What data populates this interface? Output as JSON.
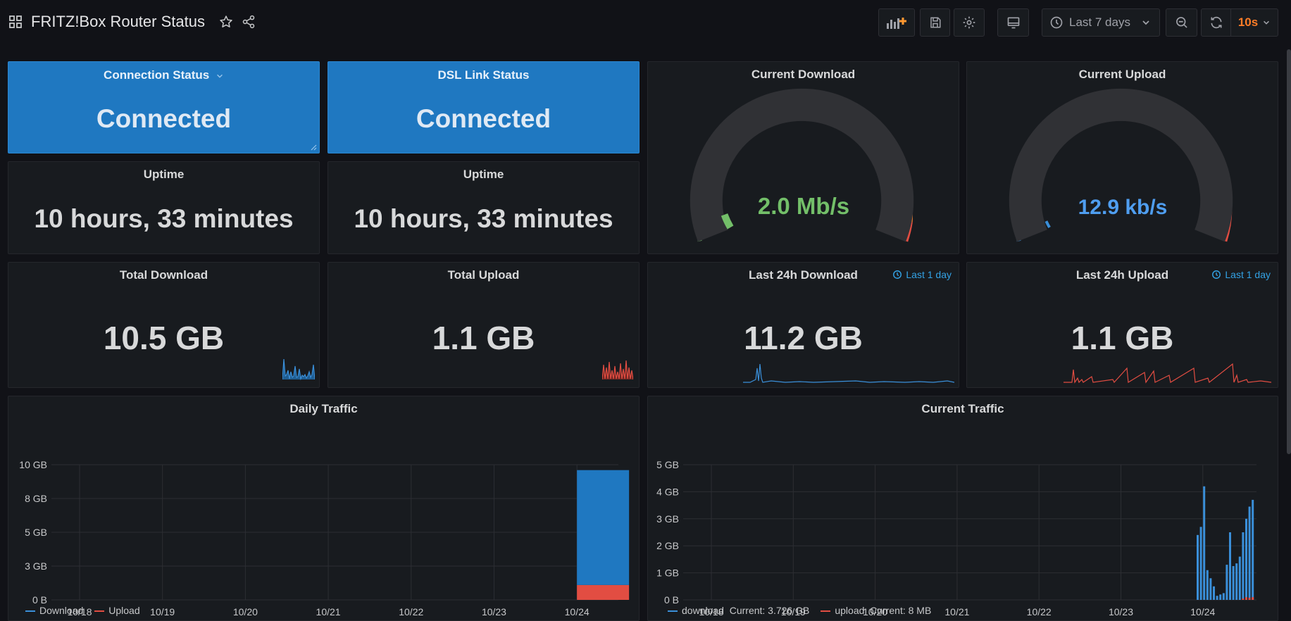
{
  "header": {
    "title": "FRITZ!Box Router Status",
    "time_range": "Last 7 days",
    "refresh": "10s"
  },
  "panels": {
    "connection_status": {
      "title": "Connection Status",
      "value": "Connected"
    },
    "dsl_link_status": {
      "title": "DSL Link Status",
      "value": "Connected"
    },
    "uptime_1": {
      "title": "Uptime",
      "value": "10 hours, 33 minutes"
    },
    "uptime_2": {
      "title": "Uptime",
      "value": "10 hours, 33 minutes"
    },
    "current_download": {
      "title": "Current Download",
      "value": "2.0 Mb/s",
      "fraction": 0.04
    },
    "current_upload": {
      "title": "Current Upload",
      "value": "12.9 kb/s",
      "fraction": 0.02
    },
    "total_download": {
      "title": "Total Download",
      "value": "10.5 GB"
    },
    "total_upload": {
      "title": "Total Upload",
      "value": "1.1 GB"
    },
    "last24_download": {
      "title": "Last 24h Download",
      "value": "11.2 GB",
      "time_info": "Last 1 day"
    },
    "last24_upload": {
      "title": "Last 24h Upload",
      "value": "1.1 GB",
      "time_info": "Last 1 day"
    },
    "daily_traffic": {
      "title": "Daily Traffic"
    },
    "current_traffic": {
      "title": "Current Traffic"
    }
  },
  "colors": {
    "blue": "#1f78c1",
    "green": "#73bf69",
    "orange": "#e0752d",
    "red": "#e24d42",
    "series_blue": "#3a8fd9"
  },
  "chart_data": [
    {
      "type": "bar",
      "title": "Daily Traffic",
      "categories": [
        "10/18",
        "10/19",
        "10/20",
        "10/21",
        "10/22",
        "10/23",
        "10/24"
      ],
      "yticks": [
        "0 B",
        "3 GB",
        "5 GB",
        "8 GB",
        "10 GB"
      ],
      "ylim": [
        0,
        10
      ],
      "stacked": true,
      "series": [
        {
          "name": "Download",
          "color": "#1f78c1",
          "values": [
            0,
            0,
            0,
            0,
            0,
            0,
            8.5
          ]
        },
        {
          "name": "Upload",
          "color": "#e24d42",
          "values": [
            0,
            0,
            0,
            0,
            0,
            0,
            1.1
          ]
        }
      ],
      "legend": [
        "Download",
        "Upload"
      ]
    },
    {
      "type": "bar",
      "title": "Current Traffic",
      "categories": [
        "10/18",
        "10/19",
        "10/20",
        "10/21",
        "10/22",
        "10/23",
        "10/24"
      ],
      "yticks": [
        "0 B",
        "1 GB",
        "2 GB",
        "3 GB",
        "4 GB",
        "5 GB"
      ],
      "ylim": [
        0,
        5
      ],
      "download": [
        2.4,
        2.7,
        4.2,
        1.1,
        0.8,
        0.5,
        0.15,
        0.2,
        0.25,
        1.3,
        2.5,
        1.25,
        1.35,
        1.6,
        2.5,
        3.0,
        3.45,
        3.7
      ],
      "upload": [
        0,
        0,
        0,
        0,
        0,
        0,
        0,
        0,
        0,
        0,
        0,
        0,
        0,
        0,
        0.05,
        0.1,
        0.08,
        0.1
      ],
      "legend": [
        "download  Current: 3.726 GB",
        "upload  Current: 8 MB"
      ]
    }
  ]
}
